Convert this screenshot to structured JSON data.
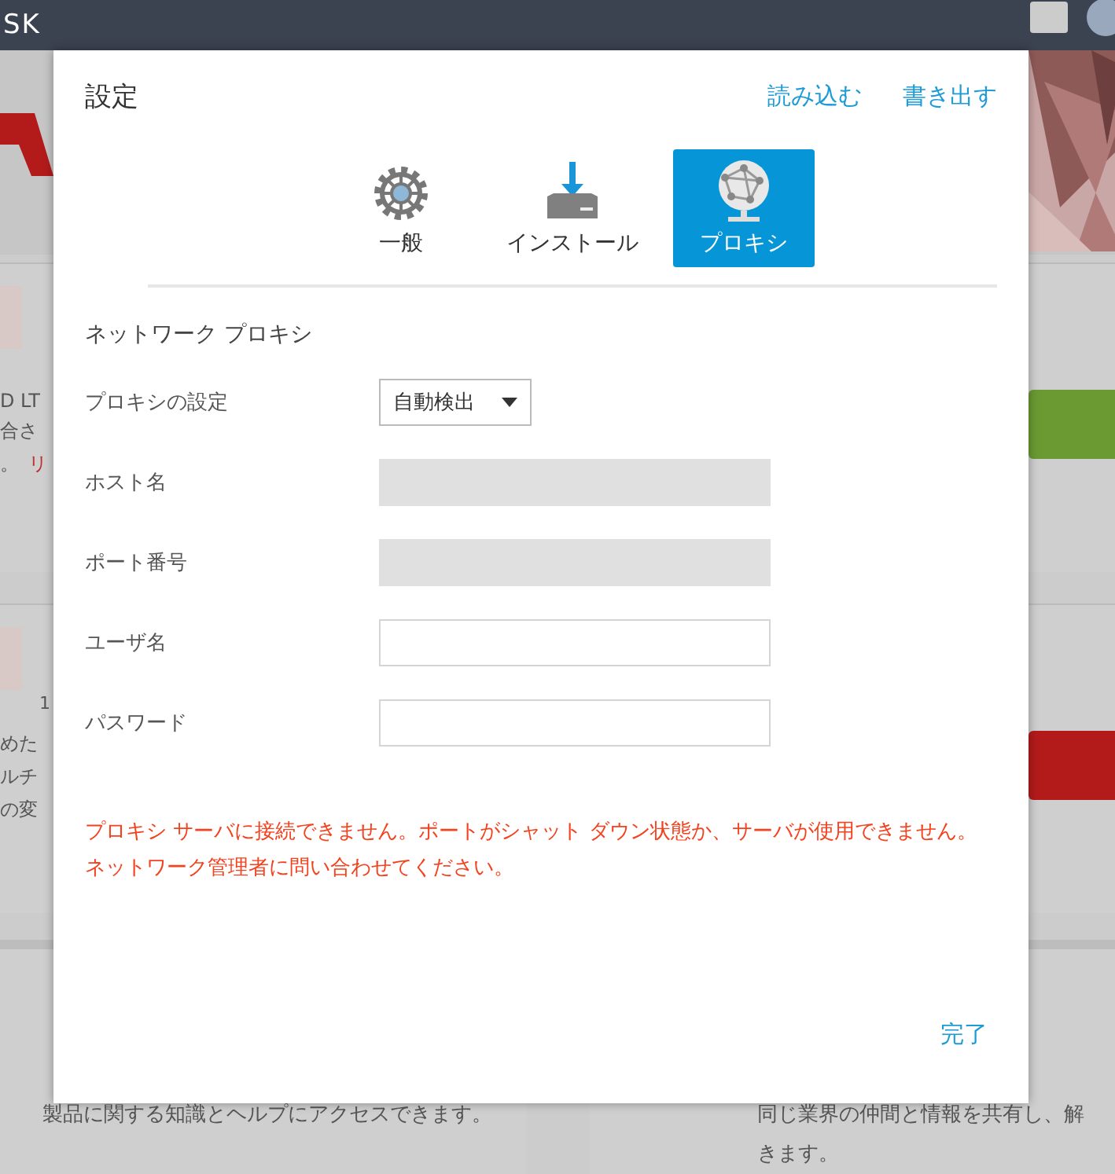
{
  "app_bar": {
    "logo_fragment": "SK"
  },
  "background_cards": [
    {
      "lines": [
        "D LT",
        "合さ"
      ],
      "tail": "。",
      "link": "リ",
      "color": "#6b9a32"
    },
    {
      "subtitle": "1",
      "lines": [
        "めた",
        "ルチ",
        "の変"
      ],
      "color": "#b31b1b"
    }
  ],
  "background_footer": [
    {
      "text": "製品に関する知識とヘルプにアクセスできます。"
    },
    {
      "text": "同じ業界の仲間と情報を共有し、解",
      "text_2": "きます。"
    }
  ],
  "dialog": {
    "title": "設定",
    "actions": [
      "読み込む",
      "書き出す"
    ],
    "tabs": [
      {
        "kind": "gear",
        "label": "一般",
        "selected": false
      },
      {
        "kind": "install",
        "label": "インストール",
        "selected": false
      },
      {
        "kind": "proxy",
        "label": "プロキシ",
        "selected": true
      }
    ],
    "section_title": "ネットワーク プロキシ",
    "fields": [
      {
        "kind": "select",
        "label": "プロキシの設定",
        "value": "自動検出",
        "disabled": false
      },
      {
        "kind": "text",
        "label": "ホスト名",
        "disabled": true
      },
      {
        "kind": "text",
        "label": "ポート番号",
        "disabled": true
      },
      {
        "kind": "text",
        "label": "ユーザ名",
        "disabled": false
      },
      {
        "kind": "password",
        "label": "パスワード",
        "disabled": false
      }
    ],
    "error": "プロキシ サーバに接続できません。ポートがシャット ダウン状態か、サーバが使用できません。ネットワーク管理者に問い合わせてください。",
    "done": "完了"
  }
}
